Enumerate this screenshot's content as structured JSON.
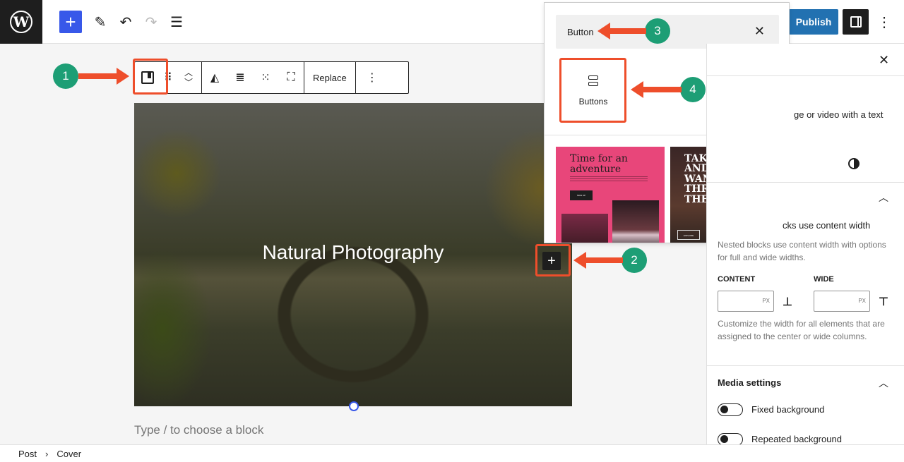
{
  "topbar": {
    "add_icon": "plus-icon",
    "publish_label": "Publish"
  },
  "block_toolbar": {
    "replace_label": "Replace"
  },
  "cover": {
    "title": "Natural Photography"
  },
  "appender": {
    "placeholder": "Type / to choose a block"
  },
  "inserter": {
    "search_value": "Button",
    "block_label": "Buttons",
    "patterns": [
      {
        "title": "Time for an adventure",
        "button": "SIGN UP"
      },
      {
        "title": "TAKE A HIKE AND WANDER THROUGH THE WOODS",
        "button": "EXPLORE"
      }
    ]
  },
  "sidebar": {
    "description_fragment": "ge or video with a text",
    "layout_text": "cks use content width",
    "layout_help": "Nested blocks use content width with options for full and wide widths.",
    "content_label": "CONTENT",
    "wide_label": "WIDE",
    "unit": "PX",
    "width_help": "Customize the width for all elements that are assigned to the center or wide columns.",
    "media_settings": "Media settings",
    "fixed_background": "Fixed background",
    "repeated_background": "Repeated background"
  },
  "breadcrumb": {
    "items": [
      "Post",
      "Cover"
    ]
  },
  "annotations": {
    "badges": [
      "1",
      "2",
      "3",
      "4"
    ],
    "color_badge": "#1d9e75",
    "color_arrow": "#ee4e2b"
  },
  "colors": {
    "accent": "#3858e9",
    "publish": "#2271b1",
    "dark": "#1e1e1e"
  }
}
